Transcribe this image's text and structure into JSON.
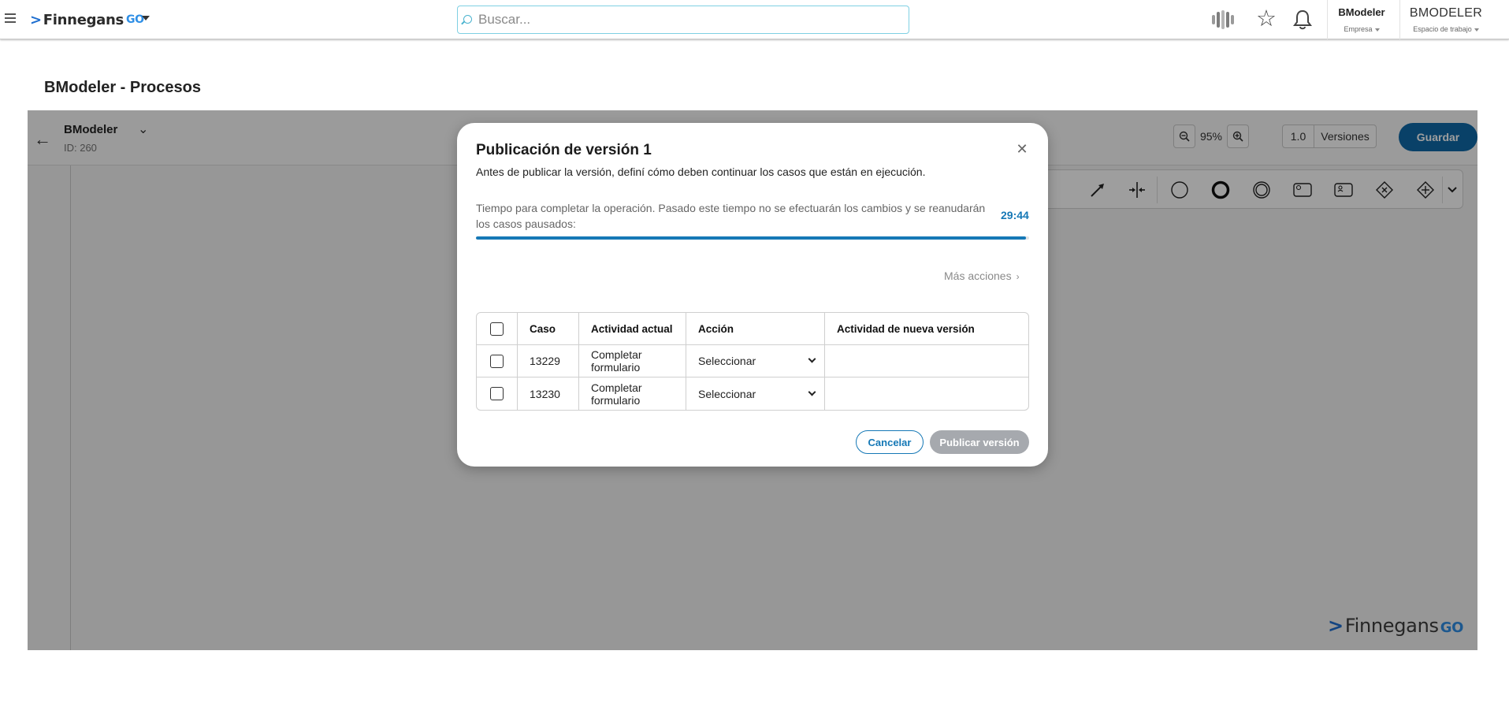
{
  "header": {
    "brand_name": "Finnegans",
    "brand_suffix": "GO",
    "search_placeholder": "Buscar...",
    "company_name": "BModeler",
    "company_label": "Empresa",
    "workspace_name": "BMODELER",
    "workspace_label": "Espacio de trabajo"
  },
  "page": {
    "title": "BModeler - Procesos"
  },
  "editor": {
    "process_name": "BModeler",
    "process_id": "ID: 260",
    "zoom": "95%",
    "version_number": "1.0",
    "versions_label": "Versiones",
    "save_label": "Guardar",
    "palette_icons": [
      "arrow-connector-icon",
      "split-icon",
      "start-event-icon",
      "end-event-icon",
      "intermediate-event-icon",
      "service-task-icon",
      "user-task-icon",
      "exclusive-gateway-icon",
      "parallel-gateway-icon",
      "expand-icon"
    ],
    "watermark_brand": "Finnegans",
    "watermark_suffix": "GO"
  },
  "modal": {
    "title": "Publicación de versión 1",
    "subtitle": "Antes de publicar la versión, definí cómo deben continuar los casos que están en ejecución.",
    "timer_text": "Tiempo para completar la operación. Pasado este tiempo no se efectuarán los cambios y se reanudarán los casos pausados:",
    "timer_value": "29:44",
    "progress_fraction": 0.995,
    "more_actions": "Más acciones",
    "table": {
      "columns": [
        "Caso",
        "Actividad actual",
        "Acción",
        "Actividad de nueva versión"
      ],
      "rows": [
        {
          "caso": "13229",
          "actividad": "Completar formulario",
          "accion": "Seleccionar",
          "nueva": ""
        },
        {
          "caso": "13230",
          "actividad": "Completar formulario",
          "accion": "Seleccionar",
          "nueva": ""
        }
      ]
    },
    "cancel_label": "Cancelar",
    "publish_label": "Publicar versión"
  },
  "colors": {
    "primary": "#1578b6",
    "save_button": "#0f6aa8",
    "disabled_button": "#a6a9ae"
  }
}
